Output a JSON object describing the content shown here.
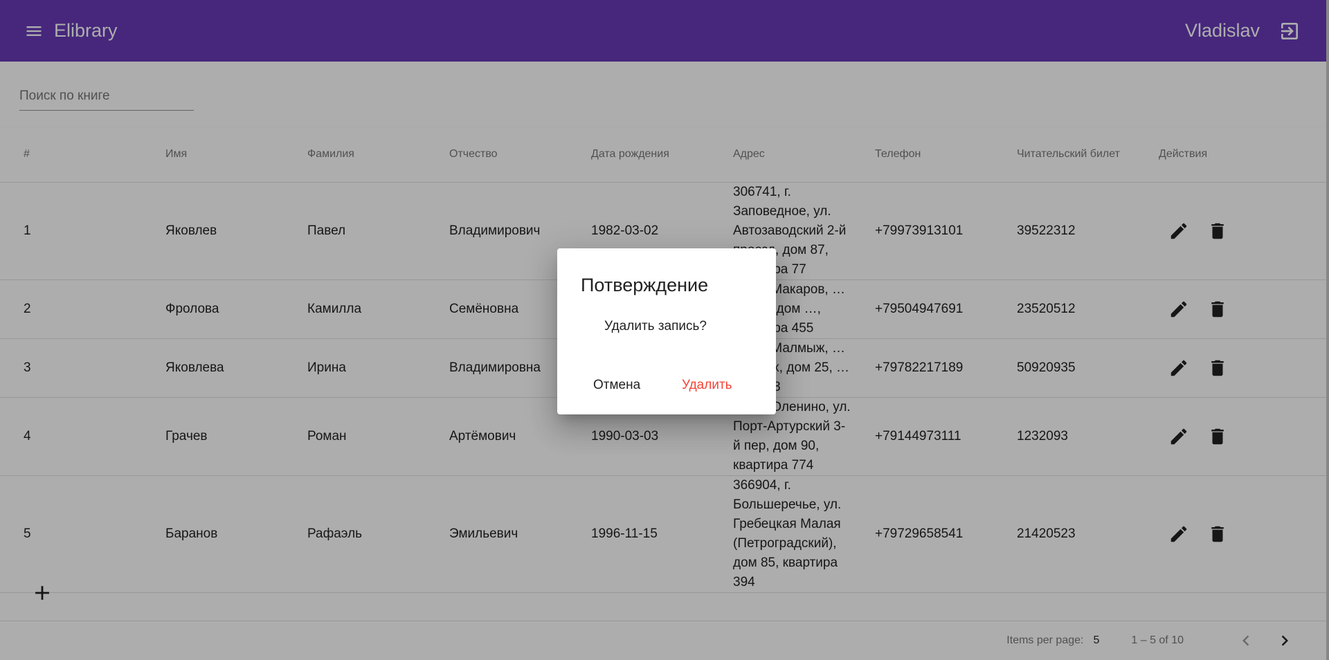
{
  "app": {
    "title": "Elibrary",
    "user": "Vladislav"
  },
  "search": {
    "placeholder": "Поиск по книге"
  },
  "table": {
    "headers": [
      "#",
      "Имя",
      "Фамилия",
      "Отчество",
      "Дата рождения",
      "Адрес",
      "Телефон",
      "Читательский билет",
      "Действия"
    ],
    "rows": [
      {
        "num": "1",
        "first": "Яковлев",
        "last": "Павел",
        "middle": "Владимирович",
        "dob": "1982-03-02",
        "address": "306741, г. Заповедное, ул. Автозаводский 2-й проезд, дом 87, квартира 77",
        "phone": "+79973913101",
        "card": "39522312"
      },
      {
        "num": "2",
        "first": "Фролова",
        "last": "Камилла",
        "middle": "Семёновна",
        "dob": "",
        "address": "…0, г. Макаров, …невой, дом …, квартира 455",
        "phone": "+79504947691",
        "card": "23520512"
      },
      {
        "num": "3",
        "first": "Яковлева",
        "last": "Ирина",
        "middle": "Владимировна",
        "dob": "",
        "address": "…8, г. Малмыж, …важных, дом 25, …ира 333",
        "phone": "+79782217189",
        "card": "50920935"
      },
      {
        "num": "4",
        "first": "Грачев",
        "last": "Роман",
        "middle": "Артёмович",
        "dob": "1990-03-03",
        "address": "…6, г. Оленино, ул. Порт-Артурский 3-й пер, дом 90, квартира 774",
        "phone": "+79144973111",
        "card": "1232093"
      },
      {
        "num": "5",
        "first": "Баранов",
        "last": "Рафаэль",
        "middle": "Эмильевич",
        "dob": "1996-11-15",
        "address": "366904, г. Большеречье, ул. Гребецкая Малая (Петроградский), дом 85, квартира 394",
        "phone": "+79729658541",
        "card": "21420523"
      }
    ]
  },
  "paginator": {
    "label": "Items per page:",
    "size": "5",
    "range": "1 – 5 of 10"
  },
  "dialog": {
    "title": "Потверждение",
    "message": "Удалить запись?",
    "cancel": "Отмена",
    "confirm": "Удалить"
  },
  "colors": {
    "primary": "#673ab7",
    "warn": "#f44336"
  },
  "icons": [
    "menu-icon",
    "logout-icon",
    "edit-icon",
    "delete-icon",
    "add-icon",
    "chevron-left-icon",
    "chevron-right-icon"
  ]
}
